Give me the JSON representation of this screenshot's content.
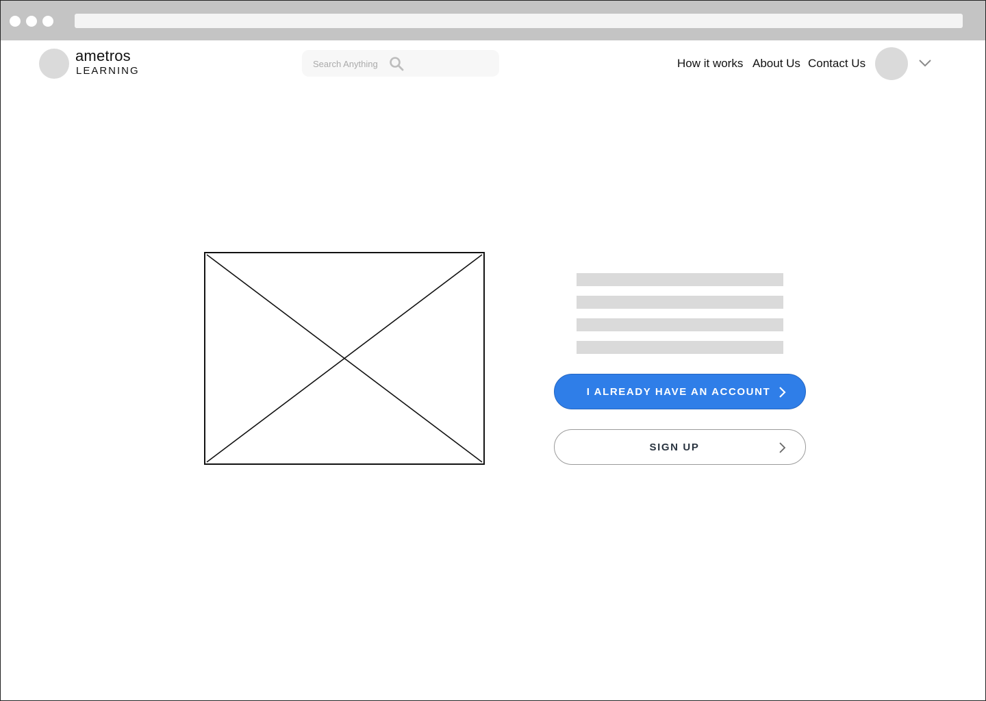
{
  "brand": {
    "name_top": "ametros",
    "name_bottom": "LEARNING"
  },
  "search": {
    "placeholder": "Search Anything",
    "value": ""
  },
  "nav": {
    "items": [
      {
        "label": "How it works"
      },
      {
        "label": "About Us"
      },
      {
        "label": "Contact Us"
      }
    ]
  },
  "hero": {
    "primary_button": "I ALREADY HAVE AN ACCOUNT",
    "secondary_button": "SIGN UP"
  },
  "colors": {
    "primary": "#2f7ee8",
    "placeholder_gray": "#dadada",
    "chrome_gray": "#c4c4c4"
  },
  "icons": {
    "search": "search-icon",
    "user_menu": "chevron-down-icon",
    "button_arrow": "chevron-right-icon",
    "image": "image-placeholder-icon"
  }
}
